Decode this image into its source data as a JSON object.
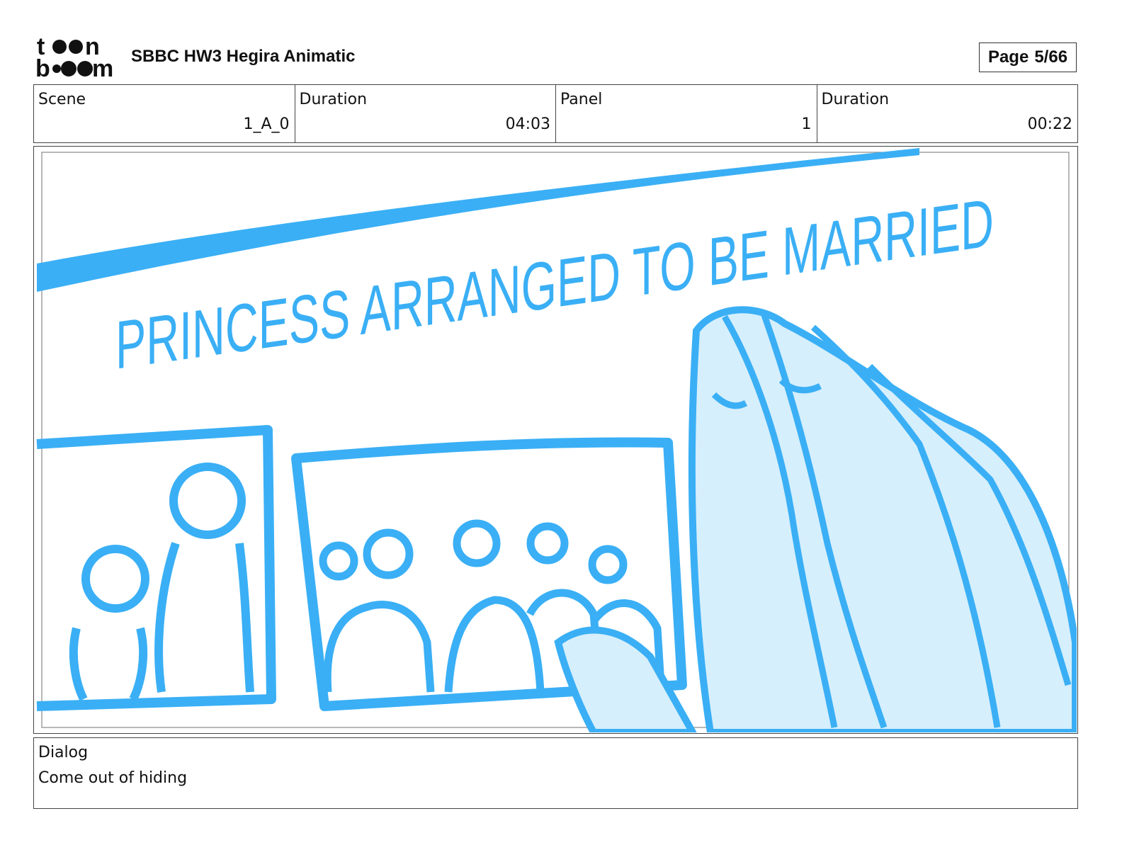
{
  "header": {
    "logo_line1": "toon",
    "logo_line2": "boom",
    "project_title": "SBBC HW3 Hegira Animatic",
    "page_label": "Page",
    "page_value": "5/66"
  },
  "info": [
    {
      "label": "Scene",
      "value": "1_A_0"
    },
    {
      "label": "Duration",
      "value": "04:03"
    },
    {
      "label": "Panel",
      "value": "1"
    },
    {
      "label": "Duration",
      "value": "00:22"
    }
  ],
  "panel": {
    "headline": "PRINCESS ARRANGED TO BE MARRIED",
    "stroke_color": "#3aaff5",
    "fill_color": "#d6effc"
  },
  "dialog": {
    "label": "Dialog",
    "text": "Come out of hiding"
  }
}
